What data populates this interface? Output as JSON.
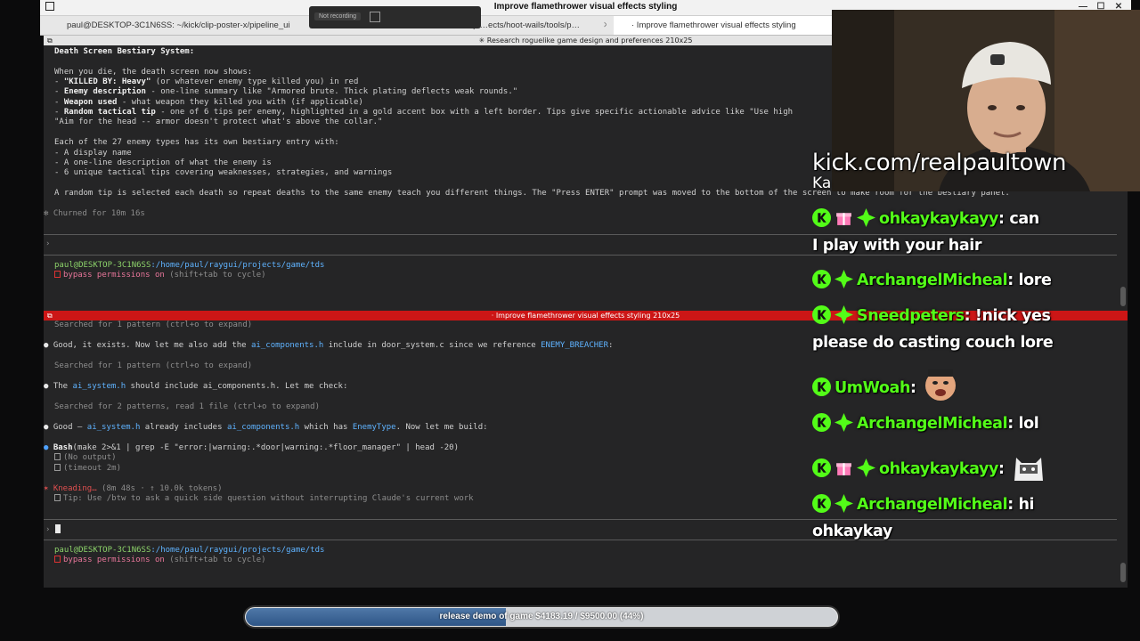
{
  "window": {
    "title": "Improve flamethrower visual effects styling",
    "controls": [
      "—",
      "☐",
      "✕"
    ]
  },
  "tabs": [
    {
      "label": "paul@DESKTOP-3C1N6SS: ~/kick/clip-poster-x/pipeline_ui",
      "active": false
    },
    {
      "label": "…/pi…ects/hoot-wails/tools/p…",
      "active": false
    },
    {
      "label": "· Improve flamethrower visual effects styling",
      "active": true
    }
  ],
  "recording": {
    "label": "Not recording"
  },
  "top_pane": {
    "title": "✳ Research roguelike game design and preferences 210x25",
    "heading": "Death Screen Bestiary System:",
    "intro": "When you die, the death screen now shows:",
    "items": [
      {
        "bold": "\"KILLED BY: Heavy\"",
        "rest": " (or whatever enemy type killed you) in red"
      },
      {
        "bold": "Enemy description",
        "rest": " - one-line summary like \"Armored brute. Thick plating deflects weak rounds.\""
      },
      {
        "bold": "Weapon used",
        "rest": " - what weapon they killed you with (if applicable)"
      },
      {
        "bold": "Random tactical tip",
        "rest": " - one of 6 tips per enemy, highlighted in a gold accent box with a left border. Tips give specific actionable advice like \"Use high"
      }
    ],
    "item_cont": "\"Aim for the head -- armor doesn't protect what's above the collar.\"",
    "entry_intro": "Each of the 27 enemy types has its own bestiary entry with:",
    "entry_items": [
      "- A display name",
      "- A one-line description of what the enemy is",
      "- 6 unique tactical tips covering weaknesses, strategies, and warnings"
    ],
    "random_tip": "A random tip is selected each death so repeat deaths to the same enemy teach you different things. The \"Press ENTER\" prompt was moved to the bottom of the screen to make room for the bestiary panel.",
    "churned": "✻ Churned for 10m 16s",
    "prompt_char": "›",
    "user_host": "paul@DESKTOP-3C1N6SS",
    "path": ":/home/paul/raygui/projects/game/tds",
    "bypass": "bypass permissions on",
    "bypass_hint": " (shift+tab to cycle)"
  },
  "bottom_pane": {
    "title": "· Improve flamethrower visual effects styling 210x25",
    "searched1": "Searched for 1 pattern (ctrl+o to expand)",
    "msg1_pre": "Good, it exists. Now let me also add the ",
    "msg1_file": "ai_components.h",
    "msg1_mid": " include in door_system.c since we reference ",
    "msg1_ref": "ENEMY_BREACHER",
    "msg1_post": ":",
    "searched2": "Searched for 1 pattern (ctrl+o to expand)",
    "msg2_pre": "The ",
    "msg2_file": "ai_system.h",
    "msg2_post": " should include ai_components.h. Let me check:",
    "searched3": "Searched for 2 patterns, read 1 file (ctrl+o to expand)",
    "msg3_pre": "Good — ",
    "msg3_file": "ai_system.h",
    "msg3_mid": " already includes ",
    "msg3_file2": "ai_components.h",
    "msg3_mid2": " which has ",
    "msg3_type": "EnemyType",
    "msg3_post": ". Now let me build:",
    "bash_cmd": "Bash",
    "bash_args": "(make 2>&1 | grep -E \"error:|warning:.*door|warning:.*floor_manager\" | head -20)",
    "no_output": "(No output)",
    "timeout": "(timeout 2m)",
    "kneading": "Kneading…",
    "kneading_info": " (8m 48s · ↑ 10.0k tokens)",
    "tip": "Tip: Use /btw to ask a quick side question without interrupting Claude's current work",
    "prompt_char": "›",
    "user_host": "paul@DESKTOP-3C1N6SS",
    "path": ":/home/paul/raygui/projects/game/tds",
    "bypass": "bypass permissions on",
    "bypass_hint": " (shift+tab to cycle)"
  },
  "stream": {
    "url": "kick.com/realpaultown",
    "clipped_name": "Ka"
  },
  "chat": [
    {
      "user": "ohkaykaykayy",
      "text": "can",
      "cont": "I play with your hair",
      "badges": [
        "kick",
        "gift",
        "sub"
      ],
      "emote": null
    },
    {
      "user": "ArchangelMicheal",
      "text": "lore",
      "cont": null,
      "badges": [
        "kick",
        "sub"
      ],
      "emote": null
    },
    {
      "user": "Sneedpeters",
      "text": "!nick yes",
      "cont": "please do casting couch lore",
      "badges": [
        "kick",
        "sub"
      ],
      "emote": null
    },
    {
      "user": "UmWoah",
      "text": "",
      "cont": null,
      "badges": [
        "kick"
      ],
      "emote": "face"
    },
    {
      "user": "ArchangelMicheal",
      "text": "lol",
      "cont": null,
      "badges": [
        "kick",
        "sub"
      ],
      "emote": null
    },
    {
      "user": "ohkaykaykayy",
      "text": "",
      "cont": null,
      "badges": [
        "kick",
        "gift",
        "sub"
      ],
      "emote": "cat"
    },
    {
      "user": "ArchangelMicheal",
      "text": "hi",
      "cont": "ohkaykay",
      "badges": [
        "kick",
        "sub"
      ],
      "emote": null
    }
  ],
  "goal": {
    "text": "release demo of game $4183.19 / $9500.00 (44%)",
    "progress": 0.44
  },
  "colors": {
    "kick_green": "#53fc18",
    "alert_red": "#cc1616",
    "goal_fill": "#2f5687"
  }
}
